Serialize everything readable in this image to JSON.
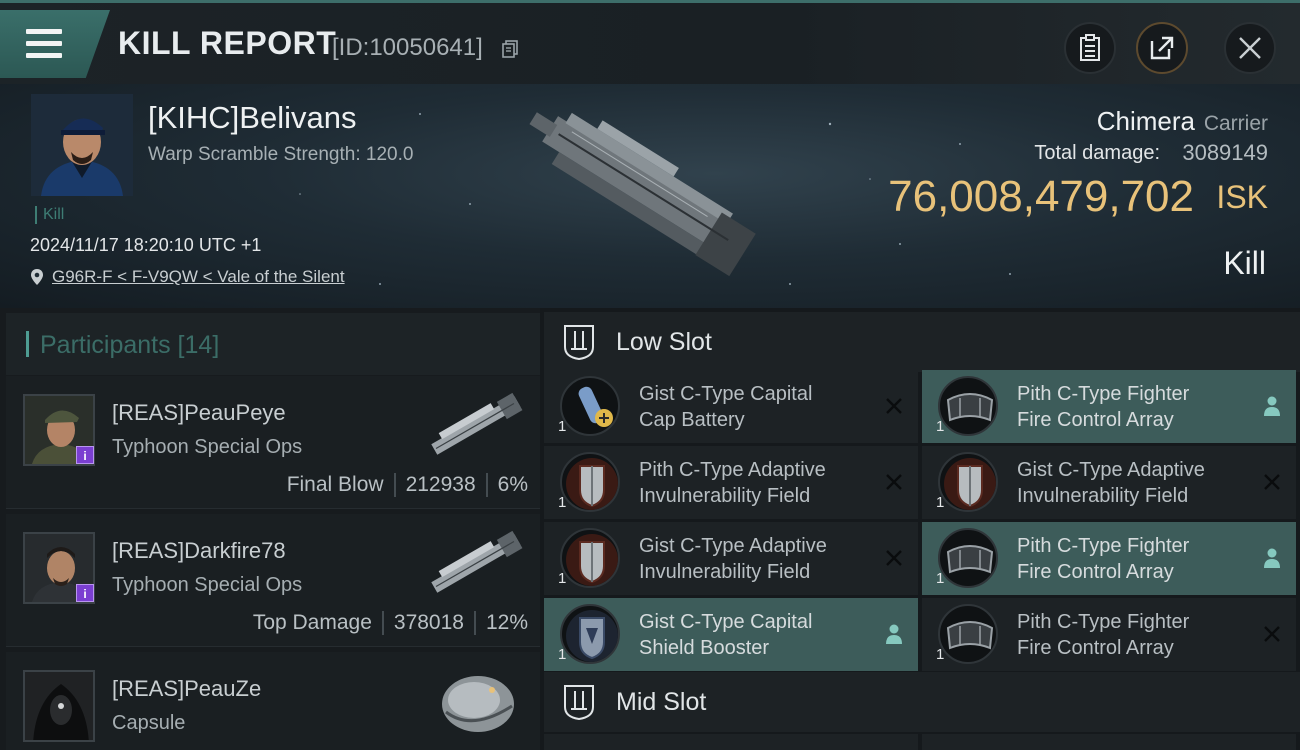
{
  "header": {
    "title": "KILL REPORT",
    "report_id": "[ID:10050641]"
  },
  "victim": {
    "name": "[KIHC]Belivans",
    "warp_scramble": "Warp Scramble Strength: 120.0",
    "tag": "Kill",
    "datetime": "2024/11/17 18:20:10 UTC +1",
    "location": "G96R-F < F-V9QW < Vale of the Silent"
  },
  "ship": {
    "name": "Chimera",
    "class": "Carrier",
    "total_damage_label": "Total damage:",
    "total_damage": "3089149",
    "isk_value": "76,008,479,702",
    "isk_unit": "ISK",
    "result": "Kill"
  },
  "participants": {
    "label": "Participants [14]",
    "rows": [
      {
        "name": "[REAS]PeauPeye",
        "ship": "Typhoon Special Ops",
        "role": "Final Blow",
        "damage": "212938",
        "percent": "6%"
      },
      {
        "name": "[REAS]Darkfire78",
        "ship": "Typhoon Special Ops",
        "role": "Top Damage",
        "damage": "378018",
        "percent": "12%"
      },
      {
        "name": "[REAS]PeauZe",
        "ship": "Capsule"
      }
    ]
  },
  "fitting": {
    "low_slot_label": "Low Slot",
    "mid_slot_label": "Mid Slot",
    "modules": [
      {
        "name_line1": "Gist C-Type Capital",
        "name_line2": "Cap Battery",
        "qty": "1",
        "status": "destroyed"
      },
      {
        "name_line1": "Pith C-Type Fighter",
        "name_line2": "Fire Control Array",
        "qty": "1",
        "status": "dropped"
      },
      {
        "name_line1": "Pith C-Type Adaptive",
        "name_line2": "Invulnerability Field",
        "qty": "1",
        "status": "destroyed"
      },
      {
        "name_line1": "Gist C-Type Adaptive",
        "name_line2": "Invulnerability Field",
        "qty": "1",
        "status": "destroyed"
      },
      {
        "name_line1": "Gist C-Type Adaptive",
        "name_line2": "Invulnerability Field",
        "qty": "1",
        "status": "destroyed"
      },
      {
        "name_line1": "Pith C-Type Fighter",
        "name_line2": "Fire Control Array",
        "qty": "1",
        "status": "dropped"
      },
      {
        "name_line1": "Gist C-Type Capital",
        "name_line2": "Shield Booster",
        "qty": "1",
        "status": "dropped"
      },
      {
        "name_line1": "Pith C-Type Fighter",
        "name_line2": "Fire Control Array",
        "qty": "1",
        "status": "destroyed"
      }
    ]
  },
  "colors": {
    "accent": "#3d6e6a",
    "isk": "#e8c27a",
    "active_module": "#3d5c5a"
  }
}
